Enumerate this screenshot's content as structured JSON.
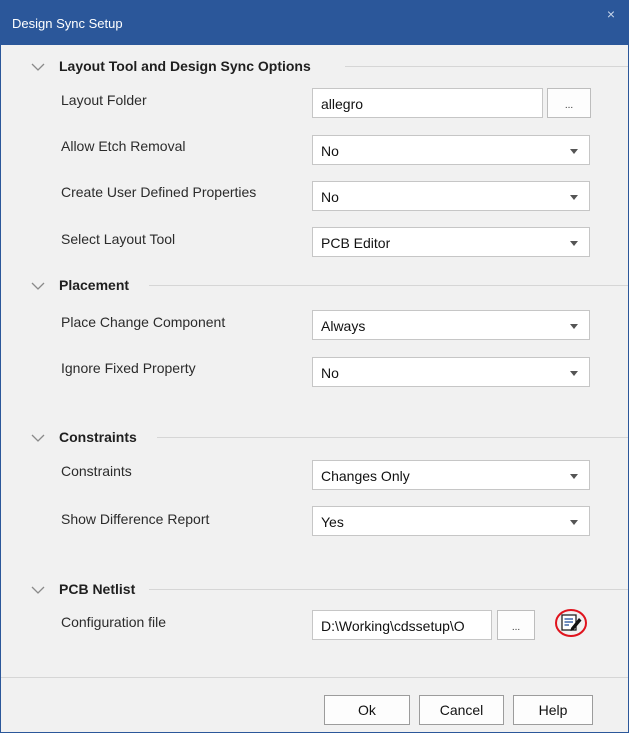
{
  "window": {
    "title": "Design Sync Setup",
    "close_glyph": "×"
  },
  "browse_label": "...",
  "sections": {
    "layout": {
      "title": "Layout Tool and Design Sync Options"
    },
    "placement": {
      "title": "Placement"
    },
    "constraints": {
      "title": "Constraints"
    },
    "netlist": {
      "title": "PCB Netlist"
    }
  },
  "fields": {
    "layout_folder": {
      "label": "Layout Folder",
      "value": "allegro"
    },
    "allow_etch_removal": {
      "label": "Allow Etch Removal",
      "value": "No"
    },
    "create_user_props": {
      "label": "Create User Defined Properties",
      "value": "No"
    },
    "select_layout_tool": {
      "label": "Select Layout Tool",
      "value": "PCB Editor"
    },
    "place_change_component": {
      "label": "Place Change Component",
      "value": "Always"
    },
    "ignore_fixed_property": {
      "label": "Ignore Fixed Property",
      "value": "No"
    },
    "constraints": {
      "label": "Constraints",
      "value": "Changes Only"
    },
    "show_difference_report": {
      "label": "Show Difference Report",
      "value": "Yes"
    },
    "configuration_file": {
      "label": "Configuration file",
      "value": "D:\\Working\\cdssetup\\O"
    }
  },
  "buttons": {
    "ok": "Ok",
    "cancel": "Cancel",
    "help": "Help"
  },
  "icons": {
    "collapse": "chevron-down-icon",
    "edit": "edit-file-icon",
    "annotation": "red-circle-highlight"
  },
  "colors": {
    "title_bar": "#2b579a",
    "dialog_bg": "#f1f1f1",
    "annotation": "#e0141e"
  }
}
